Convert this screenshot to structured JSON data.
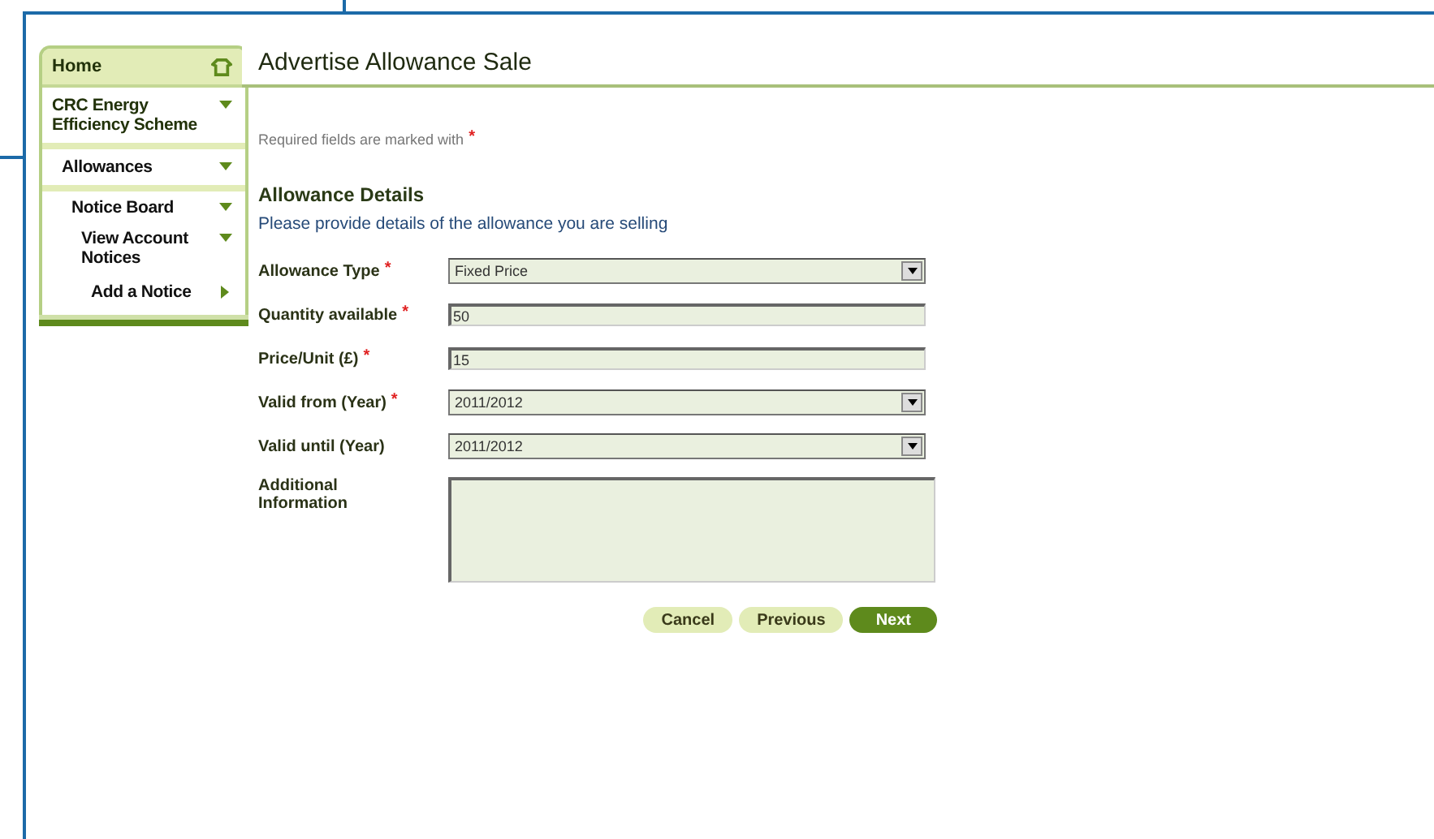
{
  "sidebar": {
    "items": [
      {
        "label": "Home",
        "kind": "home"
      },
      {
        "label": "CRC Energy Efficiency Scheme",
        "kind": "section",
        "expanded": true,
        "children": [
          {
            "label": "Allowances",
            "kind": "section",
            "expanded": true,
            "children": [
              {
                "label": "Notice Board",
                "kind": "section",
                "expanded": true,
                "children": [
                  {
                    "label": "View Account Notices",
                    "kind": "section",
                    "expanded": true
                  },
                  {
                    "label": "Add a Notice",
                    "kind": "section",
                    "expanded": false
                  }
                ]
              }
            ]
          }
        ]
      }
    ]
  },
  "page": {
    "title": "Advertise Allowance Sale",
    "required_note": "Required fields are marked with",
    "required_mark": "*"
  },
  "section": {
    "title": "Allowance Details",
    "instruction": "Please provide details of the allowance you are selling"
  },
  "fields": [
    {
      "label": "Allowance Type",
      "kind": "select",
      "required": true,
      "value": "Fixed Price"
    },
    {
      "label": "Quantity available",
      "kind": "text",
      "required": true,
      "value": "50"
    },
    {
      "label": "Price/Unit (£)",
      "kind": "text",
      "required": true,
      "value": "15"
    },
    {
      "label": "Valid from (Year)",
      "kind": "select",
      "required": true,
      "value": "2011/2012"
    },
    {
      "label": "Valid until (Year)",
      "kind": "select",
      "required": false,
      "value": "2011/2012"
    },
    {
      "label": "Additional Information",
      "kind": "textarea",
      "required": false
    }
  ],
  "buttons": [
    {
      "label": "Cancel",
      "primary": false
    },
    {
      "label": "Previous",
      "primary": false
    },
    {
      "label": "Next",
      "primary": true
    }
  ]
}
